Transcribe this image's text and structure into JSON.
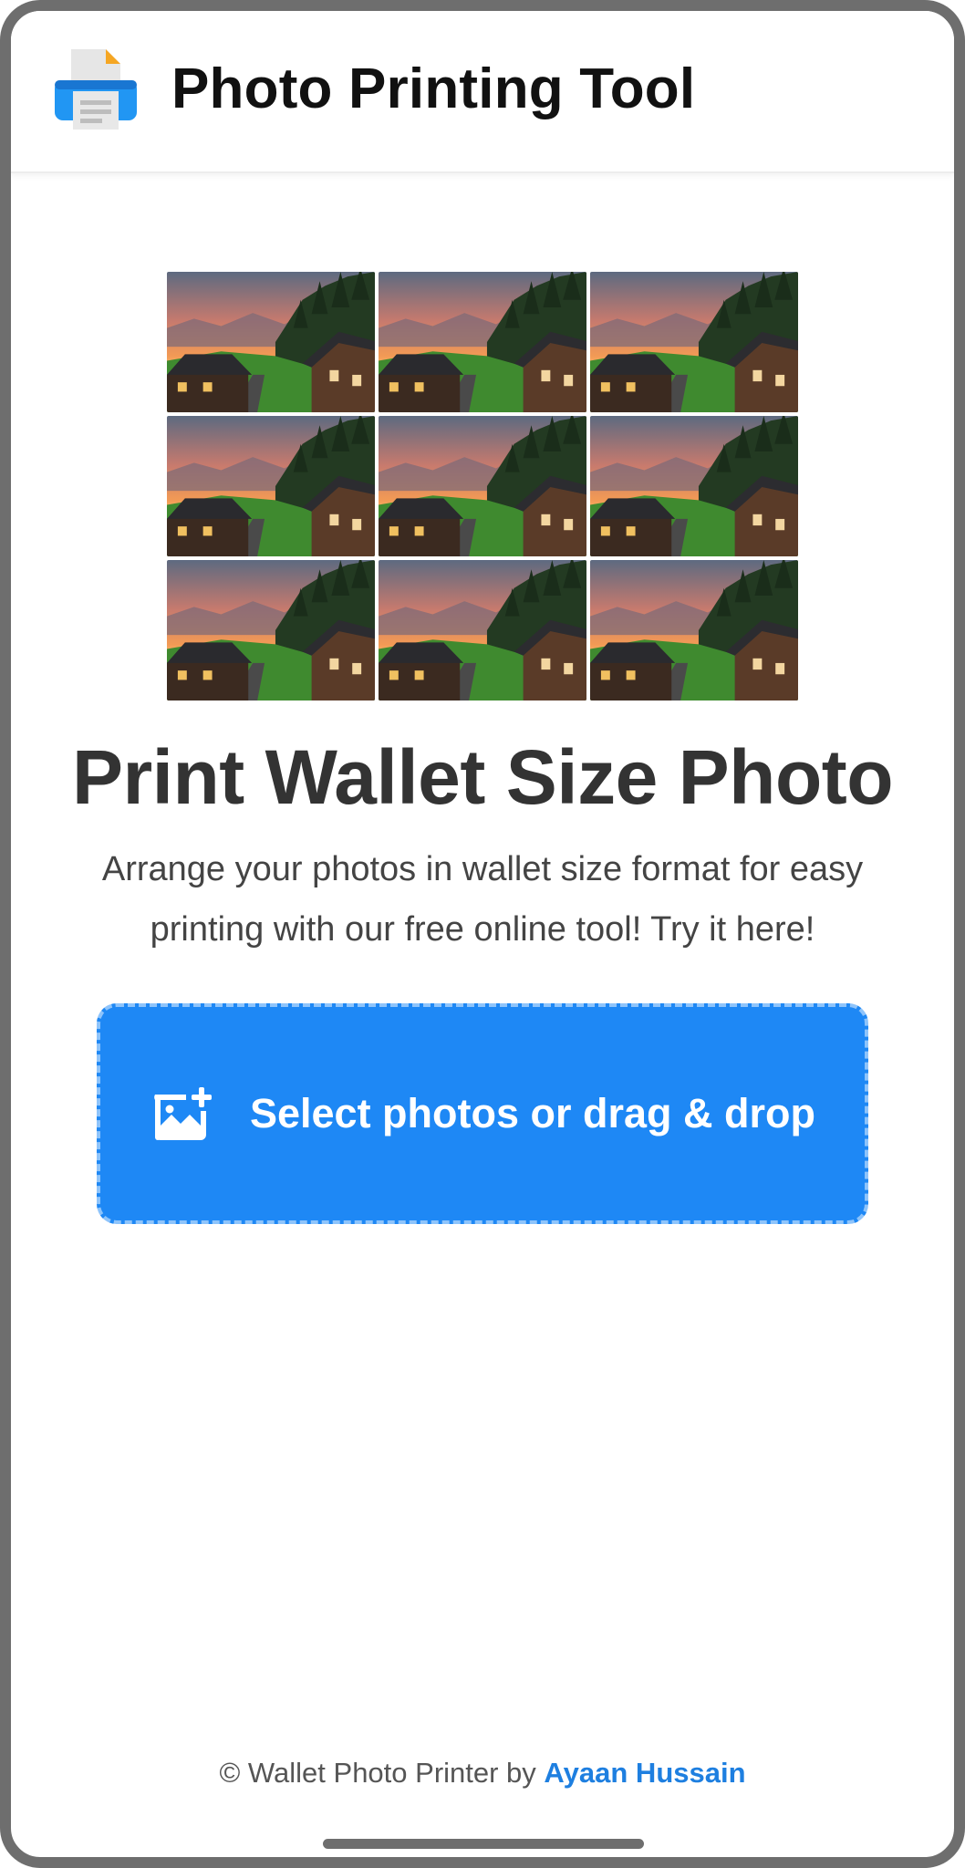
{
  "header": {
    "logo_icon": "printer-icon",
    "title": "Photo Printing Tool"
  },
  "preview": {
    "rows": 3,
    "columns": 3,
    "tile_icon": "mountain-village-sunset-photo"
  },
  "main": {
    "headline": "Print Wallet Size Photo",
    "subtext": "Arrange your photos in wallet size format for easy printing with our free online tool! Try it here!"
  },
  "upload": {
    "icon": "add-image-icon",
    "label": "Select photos or drag & drop",
    "color": "#1e88f5"
  },
  "footer": {
    "prefix": "© Wallet Photo Printer by",
    "author": "Ayaan Hussain",
    "link_color": "#1e7fe0"
  }
}
